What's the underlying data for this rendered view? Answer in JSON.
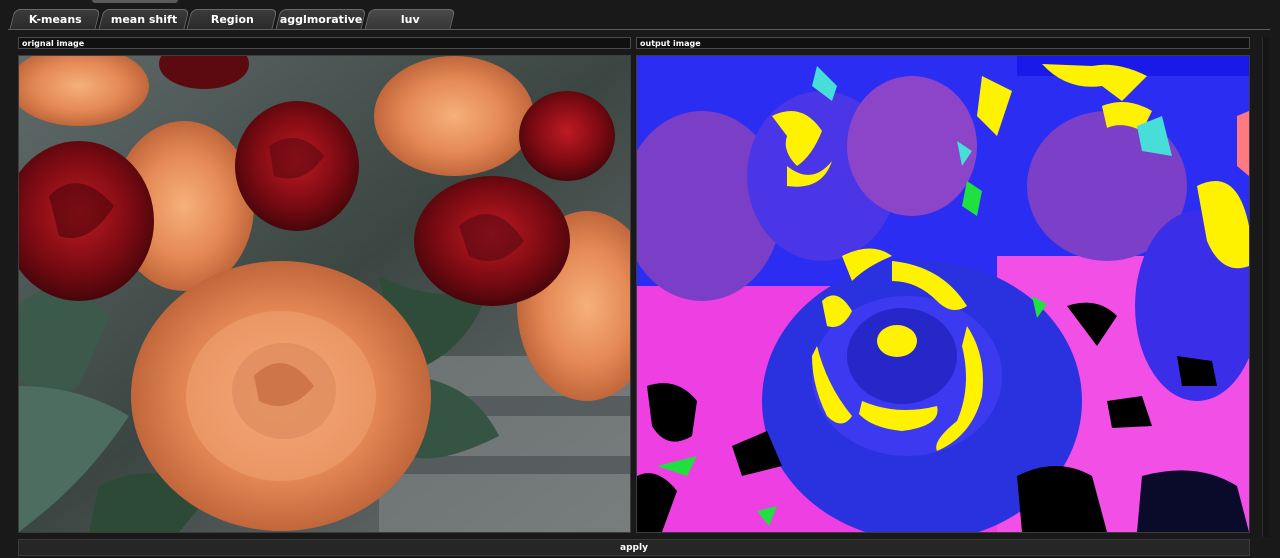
{
  "tabs": [
    {
      "label": "K-means"
    },
    {
      "label": "mean shift"
    },
    {
      "label": "Region"
    },
    {
      "label": "agglmorative"
    },
    {
      "label": "luv"
    }
  ],
  "original_panel": {
    "title": "orignal image"
  },
  "output_panel": {
    "title": "output image"
  },
  "apply_button": {
    "label": "apply"
  },
  "colors": {
    "background": "#191919",
    "panel_header": "#101010",
    "output_blue": "#3a2ee8",
    "output_magenta": "#ff40e0",
    "output_yellow": "#fff200"
  }
}
